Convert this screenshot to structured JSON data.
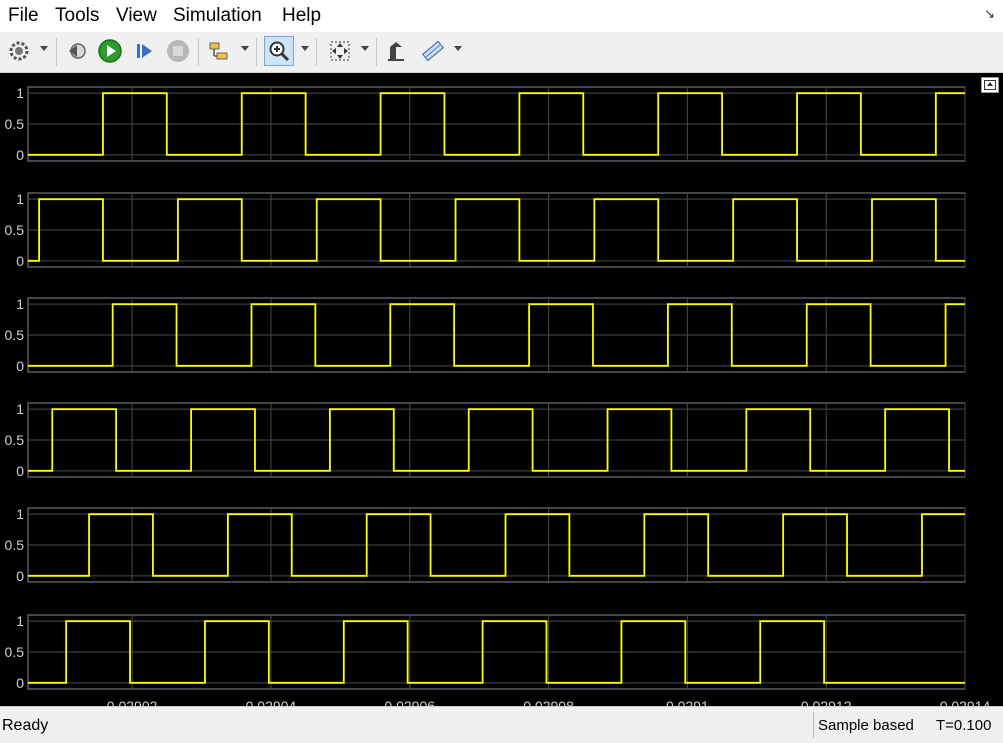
{
  "menu": {
    "file": "File",
    "tools": "Tools",
    "view": "View",
    "simulation": "Simulation",
    "help": "Help"
  },
  "toolbar": {
    "icons": [
      "gear-icon",
      "step-back-icon",
      "run-icon",
      "step-forward-icon",
      "stop-icon",
      "highlight-block-icon",
      "zoom-in-icon",
      "fit-axes-icon",
      "style-icon",
      "measurements-icon"
    ]
  },
  "colors": {
    "trace": "#ffff00",
    "axes_background": "#000000",
    "grid": "#4a4a4a",
    "tick_text": "#d0d0d0"
  },
  "status": {
    "text": "Ready",
    "mode": "Sample based",
    "time": "T=0.100"
  },
  "chart_data": {
    "type": "line",
    "x_range": [
      0.029005,
      0.02914
    ],
    "x_ticks": [
      0.02902,
      0.02904,
      0.02906,
      0.02908,
      0.0291,
      0.02912,
      0.02914
    ],
    "x_tick_labels": [
      "0.02902",
      "0.02904",
      "0.02906",
      "0.02908",
      "0.0291",
      "0.02912",
      "0.02914"
    ],
    "y_range": [
      -0.1,
      1.1
    ],
    "y_ticks": [
      0,
      0.5,
      1
    ],
    "y_tick_labels": [
      "0",
      "0.5",
      "1"
    ],
    "grid": true,
    "period": 2e-05,
    "duty": 0.46,
    "series": [
      {
        "rising_edges": [
          0.0290158,
          0.0290358,
          0.0290558,
          0.0290758,
          0.0290958,
          0.0291158,
          0.0291358
        ]
      },
      {
        "rising_edges": [
          0.0290066,
          0.0290266,
          0.0290466,
          0.0290666,
          0.0290866,
          0.0291066,
          0.0291266
        ]
      },
      {
        "rising_edges": [
          0.0290172,
          0.0290372,
          0.0290572,
          0.0290772,
          0.0290972,
          0.0291172,
          0.0291372
        ]
      },
      {
        "rising_edges": [
          0.0290085,
          0.0290285,
          0.0290485,
          0.0290685,
          0.0290885,
          0.0291085,
          0.0291285
        ]
      },
      {
        "rising_edges": [
          0.0290138,
          0.0290338,
          0.0290538,
          0.0290738,
          0.0290938,
          0.0291138,
          0.0291338
        ]
      },
      {
        "rising_edges": [
          0.0290105,
          0.0290305,
          0.0290505,
          0.0290705,
          0.0290905,
          0.0291105
        ]
      }
    ]
  }
}
